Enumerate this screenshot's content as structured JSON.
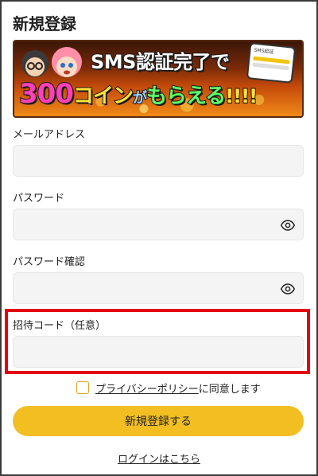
{
  "page": {
    "title": "新規登録"
  },
  "banner": {
    "top_text": "SMS認証完了で",
    "amount": "300",
    "coin": "コイン",
    "particle": "が",
    "receive": "もらえる",
    "exclaim": "!!!!",
    "phone_title": "SMS認証"
  },
  "form": {
    "email": {
      "label": "メールアドレス",
      "value": "",
      "placeholder": ""
    },
    "password": {
      "label": "パスワード",
      "value": "",
      "placeholder": ""
    },
    "password_confirm": {
      "label": "パスワード確認",
      "value": "",
      "placeholder": ""
    },
    "invite_code": {
      "label": "招待コード（任意）",
      "value": "",
      "placeholder": ""
    }
  },
  "agreement": {
    "link_text": "プライバシーポリシー",
    "suffix": "に同意します",
    "checked": false
  },
  "submit": {
    "label": "新規登録する"
  },
  "login": {
    "label": "ログインはこちら"
  },
  "colors": {
    "accent": "#f2be22",
    "highlight": "#e3000f",
    "input_bg": "#f4f4f4"
  },
  "icons": {
    "password_toggle": "eye-icon",
    "password_confirm_toggle": "eye-icon"
  }
}
